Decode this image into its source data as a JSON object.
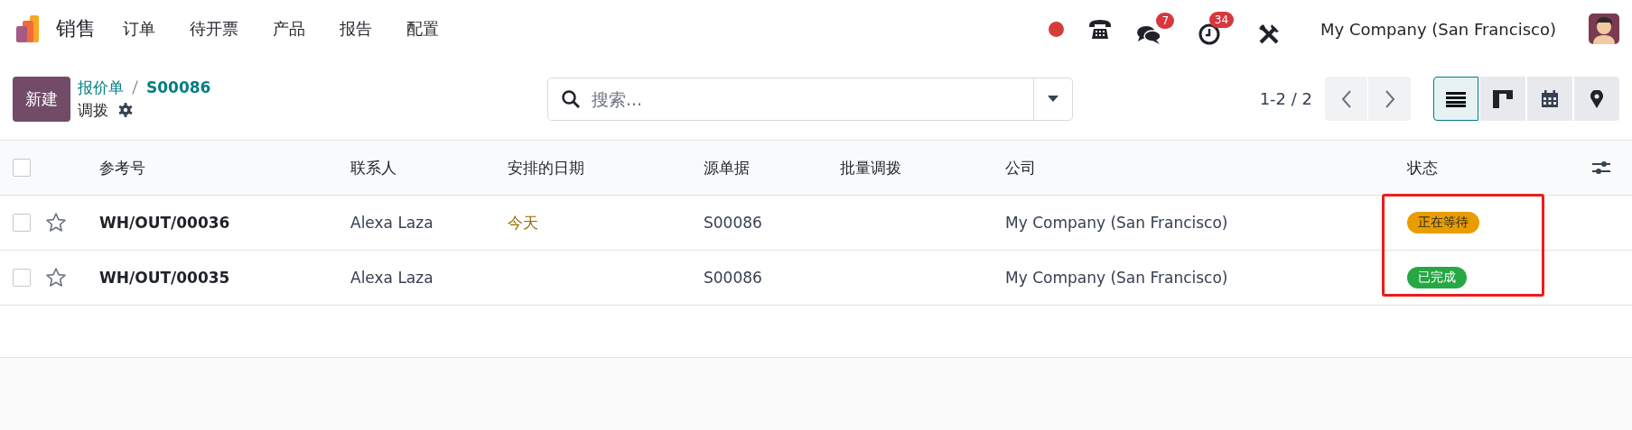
{
  "navbar": {
    "app_name": "销售",
    "menu": [
      "订单",
      "待开票",
      "产品",
      "报告",
      "配置"
    ],
    "systray": [
      {
        "kind": "record",
        "color": "#d23f3a"
      },
      {
        "kind": "phone"
      },
      {
        "kind": "chat",
        "badge": "7"
      },
      {
        "kind": "activity",
        "badge": "34"
      },
      {
        "kind": "tools"
      }
    ],
    "company": "My Company (San Francisco)"
  },
  "control_panel": {
    "new_button": "新建",
    "breadcrumb": [
      "报价单",
      "S00086"
    ],
    "title": "调拨",
    "search": {
      "placeholder": "搜索..."
    },
    "pager": "1-2 / 2",
    "views": [
      {
        "kind": "list",
        "selected": true
      },
      {
        "kind": "kanban",
        "selected": false
      },
      {
        "kind": "calendar",
        "selected": false
      },
      {
        "kind": "map",
        "selected": false
      }
    ]
  },
  "table": {
    "all_checked": false,
    "columns": [
      "参考号",
      "联系人",
      "安排的日期",
      "源单据",
      "批量调拨",
      "公司",
      "状态"
    ],
    "rows": [
      {
        "checked": false,
        "starred": false,
        "reference": "WH/OUT/00036",
        "contact": "Alexa Laza",
        "scheduled_date": "今天",
        "date_highlight": true,
        "source": "S00086",
        "company": "My Company (San Francisco)",
        "status": {
          "label": "正在等待",
          "kind": "waiting",
          "color": "#e99d00"
        }
      },
      {
        "checked": false,
        "starred": false,
        "reference": "WH/OUT/00035",
        "contact": "Alexa Laza",
        "source": "S00086",
        "company": "My Company (San Francisco)",
        "status": {
          "label": "已完成",
          "kind": "done",
          "color": "#28a745"
        }
      }
    ],
    "status_highlight": true
  }
}
